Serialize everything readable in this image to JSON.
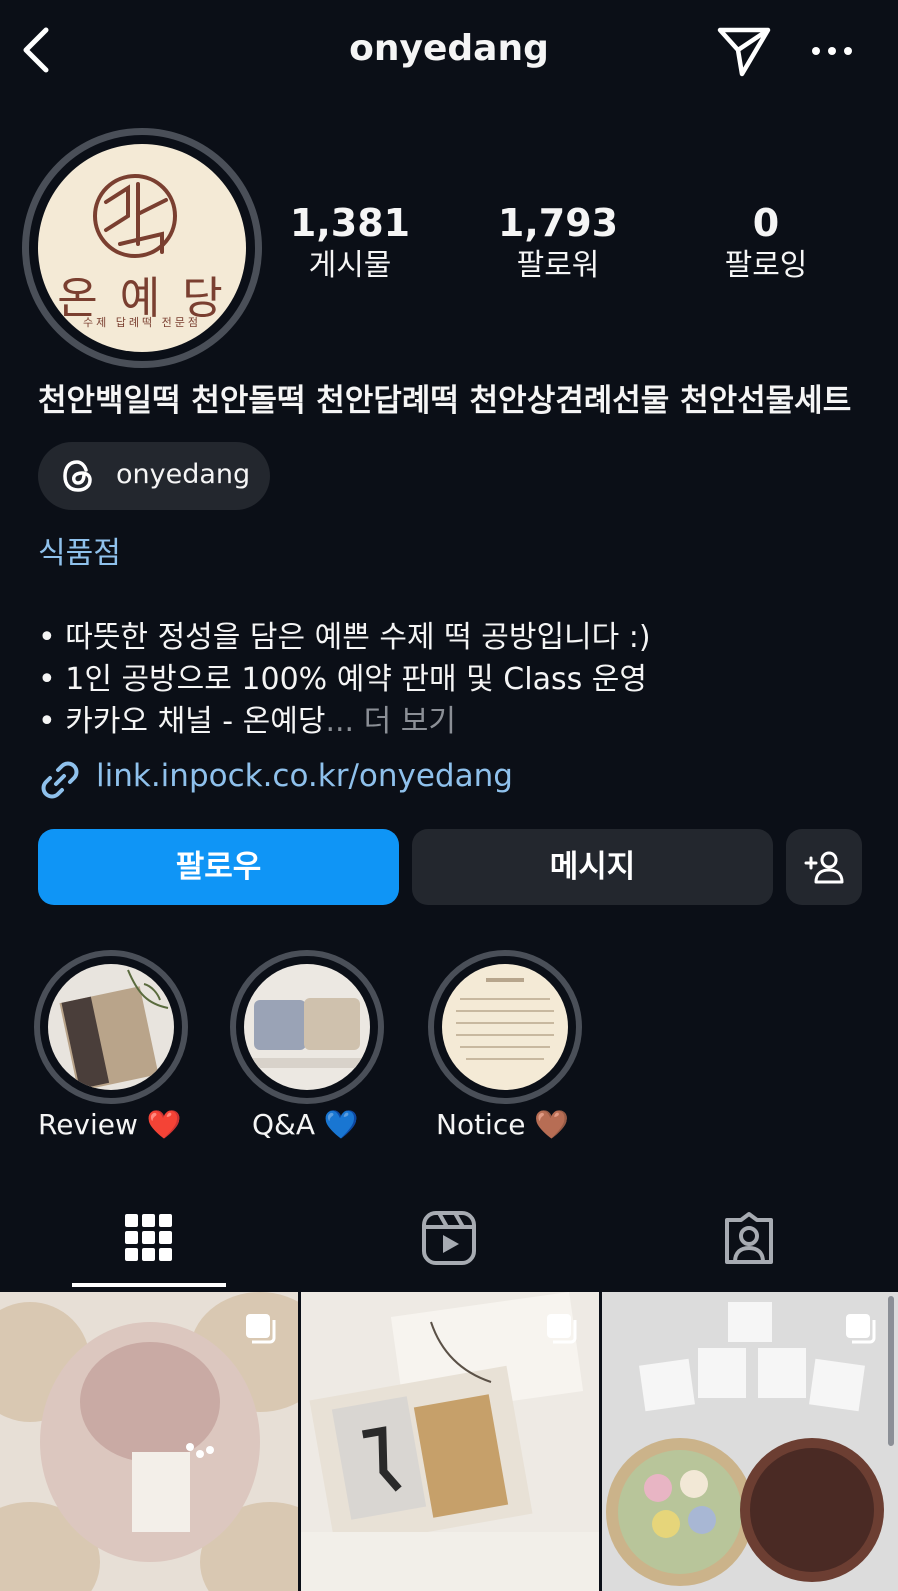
{
  "header": {
    "username": "onyedang",
    "back_icon": "chevron-left-icon",
    "send_icon": "paper-plane-icon",
    "more_icon": "more-horizontal-icon"
  },
  "profile": {
    "logo_text": "온 예 당",
    "logo_subtext": "수제 답례떡 전문점",
    "stats": [
      {
        "value": "1,381",
        "label": "게시물"
      },
      {
        "value": "1,793",
        "label": "팔로워"
      },
      {
        "value": "0",
        "label": "팔로잉"
      }
    ],
    "bio_title": "천안백일떡 천안돌떡 천안답례떡 천안상견례선물 천안선물세트",
    "threads_handle": "onyedang",
    "category": "식품점",
    "bio_lines": [
      "• 따뜻한 정성을 담은 예쁜 수제 떡 공방입니다 :)",
      "• 1인 공방으로 100% 예약 판매 및 Class 운영",
      "• 카카오 채널 - 온예당"
    ],
    "more_label": "... 더 보기",
    "link": "link.inpock.co.kr/onyedang"
  },
  "actions": {
    "follow_label": "팔로우",
    "message_label": "메시지",
    "add_person_icon": "add-person-icon"
  },
  "highlights": [
    {
      "label": "Review ❤️"
    },
    {
      "label": "Q&A 💙"
    },
    {
      "label": "Notice 🤎"
    }
  ],
  "tabs": [
    {
      "icon": "grid-icon",
      "active": true
    },
    {
      "icon": "reels-icon",
      "active": false
    },
    {
      "icon": "tagged-icon",
      "active": false
    }
  ],
  "colors": {
    "background": "#0b0f17",
    "accent": "#0f95f6",
    "link": "#8fc1ec",
    "button_dark": "#23272e"
  }
}
